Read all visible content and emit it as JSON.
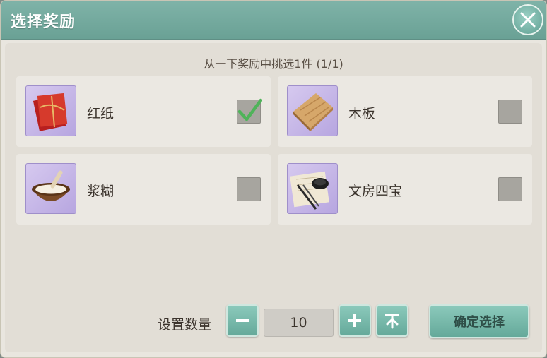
{
  "dialog": {
    "title": "选择奖励",
    "subtitle": "从一下奖励中挑选1件 (1/1)"
  },
  "items": [
    {
      "label": "红纸",
      "checked": true,
      "icon": "red-paper-icon"
    },
    {
      "label": "木板",
      "checked": false,
      "icon": "wooden-board-icon"
    },
    {
      "label": "浆糊",
      "checked": false,
      "icon": "paste-bowl-icon"
    },
    {
      "label": "文房四宝",
      "checked": false,
      "icon": "stationery-icon"
    }
  ],
  "quantity": {
    "label": "设置数量",
    "value": "10"
  },
  "confirm": {
    "label": "确定选择"
  },
  "colors": {
    "header": "#6aa195",
    "button": "#65a99a",
    "check": "#4fb35a"
  }
}
